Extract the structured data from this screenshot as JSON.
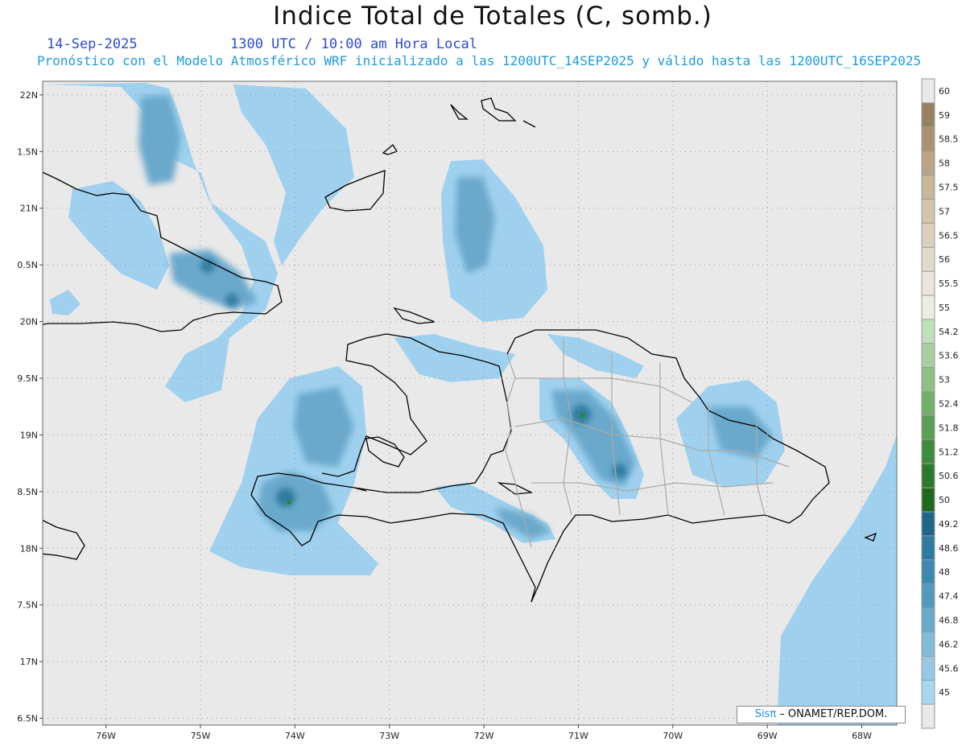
{
  "title": "Indice Total de Totales (C, somb.)",
  "date": "14-Sep-2025",
  "time": "1300 UTC / 10:00 am Hora Local",
  "subtitle": "Pronóstico con el Modelo Atmosférico WRF inicializado a las 1200UTC_14SEP2025 y válido hasta las  1200UTC_16SEP2025",
  "credit": {
    "sis": "Sisπ",
    "rest": " – ONAMET/REP.DOM."
  },
  "map": {
    "lat_labels": [
      "22N",
      "1.5N",
      "21N",
      "0.5N",
      "20N",
      "9.5N",
      "19N",
      "8.5N",
      "18N",
      "7.5N",
      "17N",
      "6.5N"
    ],
    "lat_values": [
      22,
      21.5,
      21,
      20.5,
      20,
      19.5,
      19,
      18.5,
      18,
      17.5,
      17,
      16.5
    ],
    "lon_labels": [
      "76W",
      "75W",
      "74W",
      "73W",
      "72W",
      "71W",
      "70W",
      "69W",
      "68W"
    ],
    "lon_values": [
      -76,
      -75,
      -74,
      -73,
      -72,
      -71,
      -70,
      -69,
      -68
    ],
    "lat_range": [
      16.44,
      22.12
    ],
    "lon_range": [
      -76.67,
      -67.63
    ],
    "background_color": "#e9e9e9",
    "gridlines": "dotted"
  },
  "colorbar": {
    "labels": [
      "60",
      "59",
      "58.5",
      "58",
      "57.5",
      "57",
      "56.5",
      "56",
      "55.5",
      "55",
      "54.2",
      "53.6",
      "53",
      "52.4",
      "51.8",
      "51.2",
      "50.6",
      "50",
      "49.2",
      "48.6",
      "48",
      "47.4",
      "46.8",
      "46.2",
      "45.6",
      "45"
    ],
    "colors": [
      "#e9e9e9",
      "#978260",
      "#a99272",
      "#b9a486",
      "#c9b598",
      "#d3c4ab",
      "#dccfbb",
      "#e3d9cb",
      "#ebe5db",
      "#eeebe4",
      "#c0dfbb",
      "#a8cf9f",
      "#8fc084",
      "#75b06b",
      "#5b9f54",
      "#3f8c3d",
      "#2b7a2d",
      "#1e6b1f",
      "#206688",
      "#2e7aa0",
      "#3d88b0",
      "#5199bf",
      "#68aacb",
      "#80bbd7",
      "#95c9e5",
      "#a8d6f1",
      "#e9e9e9"
    ]
  }
}
